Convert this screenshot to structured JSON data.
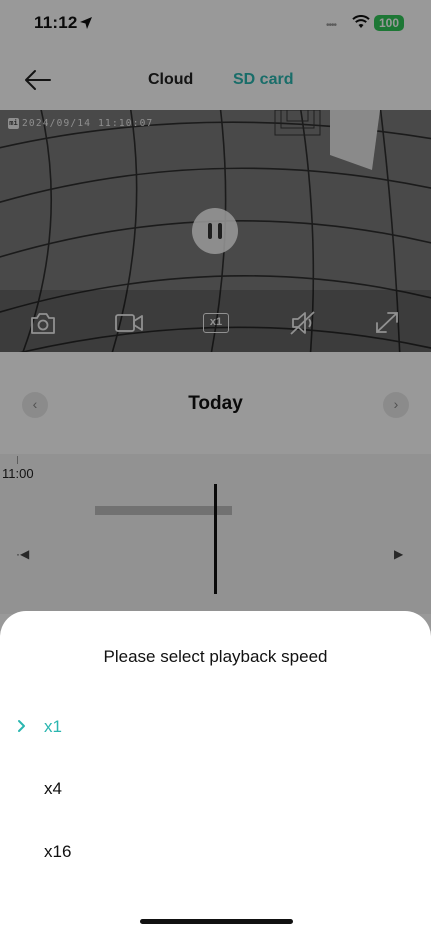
{
  "status_bar": {
    "time": "11:12",
    "battery": "100",
    "icons": [
      "location-arrow-icon",
      "cellular-dots-icon",
      "wifi-icon"
    ]
  },
  "nav": {
    "back_icon": "arrow-left-icon",
    "tabs": [
      {
        "label": "Cloud",
        "active": false
      },
      {
        "label": "SD card",
        "active": true
      }
    ]
  },
  "video": {
    "timestamp": "2024/09/14  11:10:07",
    "logo_text": "mi",
    "state": "playing",
    "controls": {
      "screenshot_icon": "camera-icon",
      "record_icon": "video-camera-icon",
      "speed_label": "x1",
      "mute_icon": "speaker-muted-icon",
      "fullscreen_icon": "expand-icon"
    }
  },
  "date_nav": {
    "title": "Today",
    "prev_icon": "chevron-left-icon",
    "next_icon": "chevron-right-icon"
  },
  "timeline": {
    "label": "11:00",
    "prev_glyph": "·◀",
    "next_glyph": "▶"
  },
  "speed_sheet": {
    "title": "Please select playback speed",
    "options": [
      {
        "label": "x1",
        "selected": true
      },
      {
        "label": "x4",
        "selected": false
      },
      {
        "label": "x16",
        "selected": false
      }
    ]
  },
  "colors": {
    "accent": "#2bb6b0",
    "battery": "#31c759"
  }
}
